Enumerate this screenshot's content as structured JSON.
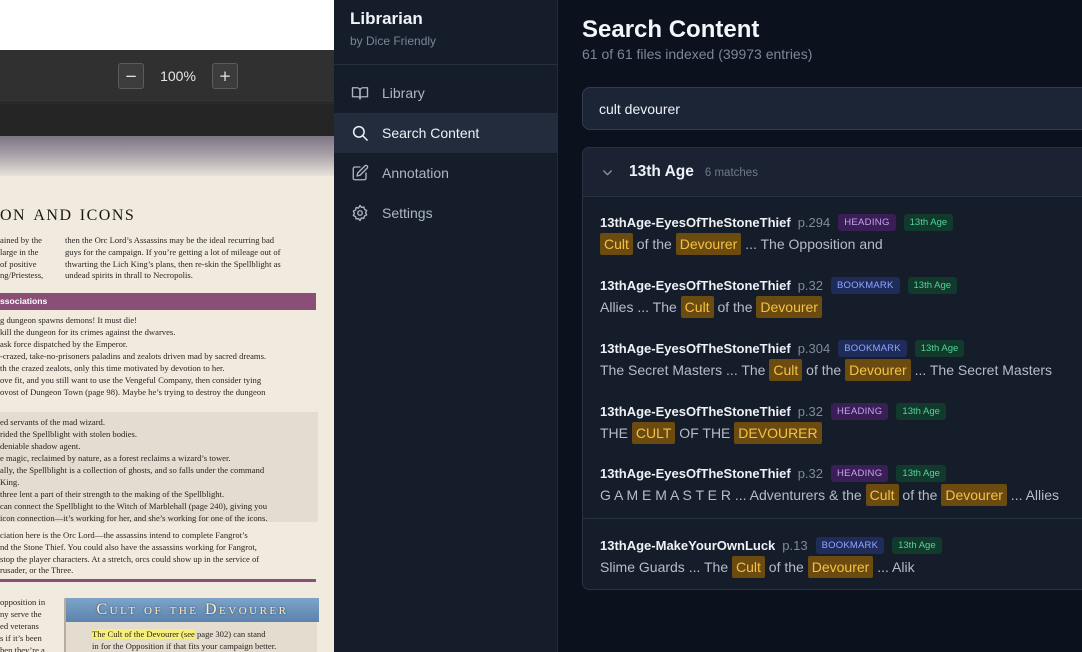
{
  "pdf_viewer": {
    "zoom_out_label": "−",
    "zoom_level": "100%",
    "zoom_in_label": "+",
    "page": {
      "title": "on and icons",
      "left_col": [
        "ained by the",
        "large in the",
        "of positive",
        "ng/Priestess,"
      ],
      "right_col": [
        "then the Orc Lord’s Assassins may be the ideal recurring bad",
        "guys for the campaign. If you’re getting a lot of mileage out of",
        "thwarting the Lich King’s plans, then re-skin the Spellblight as",
        "undead spirits in thrall to Necropolis."
      ],
      "assoc_heading": "ssociations",
      "list_a": [
        "g dungeon spawns demons! It must die!",
        "kill the dungeon for its crimes against the dwarves.",
        "ask force dispatched by the Emperor.",
        "-crazed, take-no-prisoners paladins and zealots driven mad by sacred dreams.",
        "th the crazed zealots, only this time motivated by devotion to her.",
        "ove fit, and you still want to use the Vengeful Company, then consider tying",
        "ovost of Dungeon Town (page 98). Maybe he’s trying to destroy the dungeon"
      ],
      "list_b": [
        "ed servants of the mad wizard.",
        "rided the Spellblight with stolen bodies.",
        "deniable shadow agent.",
        "e magic, reclaimed by nature, as a forest reclaims a wizard’s tower.",
        "ally, the Spellblight is a collection of ghosts, and so falls under the command",
        "King.",
        "three lent a part of their strength to the making of the Spellblight.",
        "can connect the Spellblight to the Witch of Marblehall (page 240), giving you",
        "icon connection—it’s working for her, and she’s working for one of the icons."
      ],
      "para_c": [
        "ciation here is the Orc Lord—the assassins intend to complete Fangrot’s",
        "nd the Stone Thief. You could also have the assassins working for Fangrot,",
        "stop the player characters. At a stretch, orcs could show up in the service of",
        "rusader, or the Three."
      ],
      "bottom_left": [
        "opposition in",
        "ny serve the",
        "ed veterans",
        "s if it’s been",
        "hen they’re a"
      ],
      "devourer_banner": "Cult of the Devourer",
      "devourer_highlight": "The Cult of the Devourer (see",
      "devourer_rest": " page 302) can stand",
      "devourer_line2": "in for the Opposition if that fits your campaign better."
    }
  },
  "sidebar": {
    "app_name": "Librarian",
    "app_byline": "by Dice Friendly",
    "items": [
      {
        "label": "Library",
        "icon": "book-icon",
        "active": false
      },
      {
        "label": "Search Content",
        "icon": "search-icon",
        "active": true
      },
      {
        "label": "Annotation",
        "icon": "pencil-icon",
        "active": false
      },
      {
        "label": "Settings",
        "icon": "gear-icon",
        "active": false
      }
    ]
  },
  "main": {
    "title": "Search Content",
    "subtitle": "61 of 61 files indexed (39973 entries)",
    "search_value": "cult devourer",
    "group": {
      "name": "13th Age",
      "count": "6 matches",
      "results": [
        {
          "file": "13thAge-EyesOfTheStoneThief",
          "page": "p.294",
          "type": "HEADING",
          "system": "13th Age",
          "snippet": [
            {
              "t": "Cult",
              "m": true
            },
            {
              "t": " of the ",
              "m": false
            },
            {
              "t": "Devourer",
              "m": true
            },
            {
              "t": " ... The Opposition and",
              "m": false
            }
          ]
        },
        {
          "file": "13thAge-EyesOfTheStoneThief",
          "page": "p.32",
          "type": "BOOKMARK",
          "system": "13th Age",
          "snippet": [
            {
              "t": "Allies ... The ",
              "m": false
            },
            {
              "t": "Cult",
              "m": true
            },
            {
              "t": " of the ",
              "m": false
            },
            {
              "t": "Devourer",
              "m": true
            }
          ]
        },
        {
          "file": "13thAge-EyesOfTheStoneThief",
          "page": "p.304",
          "type": "BOOKMARK",
          "system": "13th Age",
          "snippet": [
            {
              "t": "The Secret Masters ... The ",
              "m": false
            },
            {
              "t": "Cult",
              "m": true
            },
            {
              "t": " of the ",
              "m": false
            },
            {
              "t": "Devourer",
              "m": true
            },
            {
              "t": " ... The Secret Masters",
              "m": false
            }
          ]
        },
        {
          "file": "13thAge-EyesOfTheStoneThief",
          "page": "p.32",
          "type": "HEADING",
          "system": "13th Age",
          "snippet": [
            {
              "t": "THE ",
              "m": false
            },
            {
              "t": "CULT",
              "m": true
            },
            {
              "t": " OF THE ",
              "m": false
            },
            {
              "t": "DEVOURER",
              "m": true
            }
          ]
        },
        {
          "file": "13thAge-EyesOfTheStoneThief",
          "page": "p.32",
          "type": "HEADING",
          "system": "13th Age",
          "snippet": [
            {
              "t": "G A M E M A S T E R ... Adventurers & the ",
              "m": false
            },
            {
              "t": "Cult",
              "m": true
            },
            {
              "t": " of the ",
              "m": false
            },
            {
              "t": "Devourer",
              "m": true
            },
            {
              "t": " ... Allies",
              "m": false
            }
          ]
        },
        {
          "file": "13thAge-MakeYourOwnLuck",
          "page": "p.13",
          "type": "BOOKMARK",
          "system": "13th Age",
          "snippet": [
            {
              "t": "Slime Guards ... The ",
              "m": false
            },
            {
              "t": "Cult",
              "m": true
            },
            {
              "t": " of the ",
              "m": false
            },
            {
              "t": "Devourer",
              "m": true
            },
            {
              "t": " ... Alik",
              "m": false
            }
          ]
        }
      ]
    }
  },
  "colors": {
    "app_bg": "#0b111d",
    "sidebar_bg": "#151d2b",
    "highlight_bg": "#6b4b0f",
    "highlight_text": "#f6c244",
    "heading_badge": "#c9a0f2",
    "bookmark_badge": "#8ea6ff",
    "system_badge": "#52d29a"
  }
}
